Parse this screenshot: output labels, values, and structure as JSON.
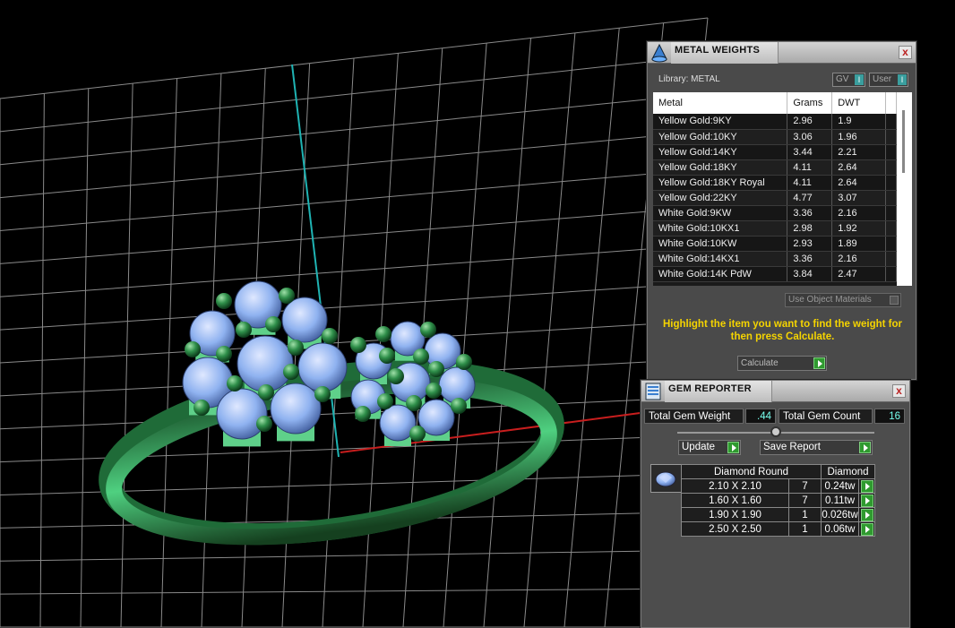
{
  "metal_weights": {
    "title": "METAL WEIGHTS",
    "library_label": "Library: METAL",
    "gv_toggle": "GV",
    "user_toggle": "User",
    "toggle_knob": "I",
    "columns": [
      "Metal",
      "Grams",
      "DWT"
    ],
    "rows": [
      [
        "Yellow Gold:9KY",
        "2.96",
        "1.9"
      ],
      [
        "Yellow Gold:10KY",
        "3.06",
        "1.96"
      ],
      [
        "Yellow Gold:14KY",
        "3.44",
        "2.21"
      ],
      [
        "Yellow Gold:18KY",
        "4.11",
        "2.64"
      ],
      [
        "Yellow Gold:18KY Royal",
        "4.11",
        "2.64"
      ],
      [
        "Yellow Gold:22KY",
        "4.77",
        "3.07"
      ],
      [
        "White Gold:9KW",
        "3.36",
        "2.16"
      ],
      [
        "White Gold:10KX1",
        "2.98",
        "1.92"
      ],
      [
        "White Gold:10KW",
        "2.93",
        "1.89"
      ],
      [
        "White Gold:14KX1",
        "3.36",
        "2.16"
      ],
      [
        "White Gold:14K PdW",
        "3.84",
        "2.47"
      ]
    ],
    "use_object_materials": "Use Object Materials",
    "hint": "Highlight the item you want to find the weight for then press Calculate.",
    "calculate_label": "Calculate",
    "close": "x"
  },
  "gem_reporter": {
    "title": "GEM REPORTER",
    "total_weight_label": "Total Gem Weight",
    "total_weight_value": ".44",
    "total_count_label": "Total Gem Count",
    "total_count_value": "16",
    "update_label": "Update",
    "save_report_label": "Save Report",
    "table_headers": [
      "Diamond Round",
      "Diamond"
    ],
    "rows": [
      [
        "2.10 X 2.10",
        "7",
        "0.24tw"
      ],
      [
        "1.60 X 1.60",
        "7",
        "0.11tw"
      ],
      [
        "1.90 X 1.90",
        "1",
        "0.026tw"
      ],
      [
        "2.50 X 2.50",
        "1",
        "0.06tw"
      ]
    ],
    "close": "x"
  },
  "colors": {
    "grid": "#8a8a8a",
    "band": "#3fb86a",
    "gem": "#8fb2f0",
    "bead": "#2f8f4a",
    "axis_y": "#1fb3b3",
    "axis_x": "#c81e1e",
    "hint": "#f5d400"
  }
}
